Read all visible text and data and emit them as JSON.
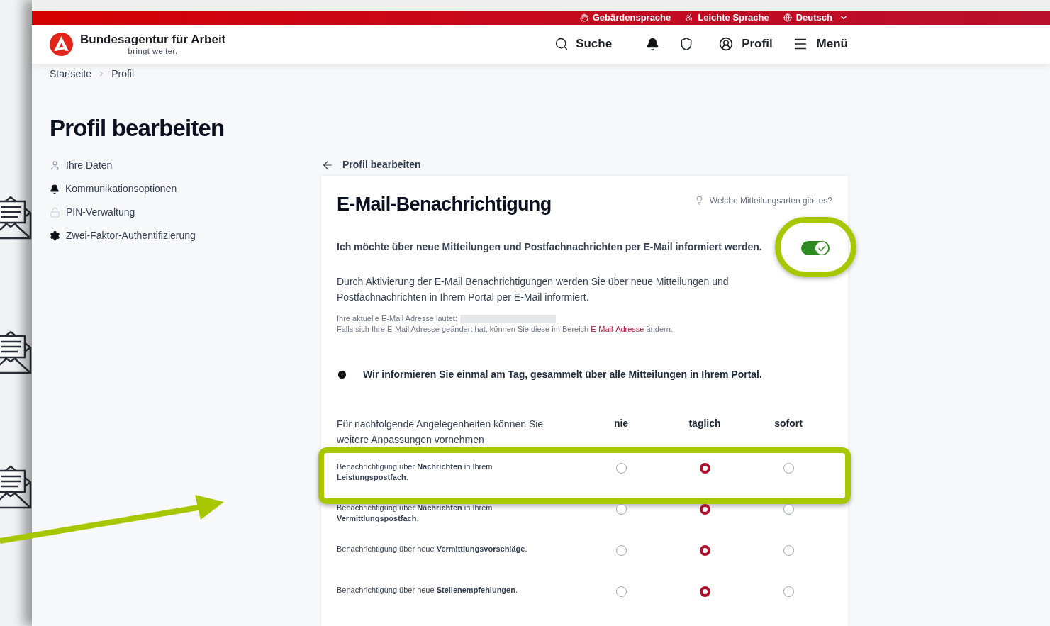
{
  "topbar": {
    "links": [
      {
        "kind": "sign",
        "label": "Gebärdensprache"
      },
      {
        "kind": "easy",
        "label": "Leichte Sprache"
      },
      {
        "kind": "language",
        "label": "Deutsch"
      }
    ]
  },
  "header": {
    "brand": "Bundesagentur für Arbeit",
    "tagline": "bringt weiter.",
    "search": "Suche",
    "profile": "Profil",
    "menu": "Menü"
  },
  "breadcrumbs": [
    "Startseite",
    "Profil"
  ],
  "page_title": "Profil bearbeiten",
  "sidebar": {
    "items": [
      {
        "kind": "person",
        "label": "Ihre Daten"
      },
      {
        "kind": "bell",
        "label": "Kommunikationsoptionen"
      },
      {
        "kind": "lock",
        "label": "PIN-Verwaltung"
      },
      {
        "kind": "gear",
        "label": "Zwei-Faktor-Authentifizierung"
      }
    ]
  },
  "back_link": "Profil bearbeiten",
  "card": {
    "title": "E-Mail-Benachrichtigung",
    "help_link": "Welche Mitteilungsarten gibt es?",
    "toggle": {
      "label": "Ich möchte über neue Mitteilungen und Postfachnachrichten per E-Mail informiert werden.",
      "on": true
    },
    "description": "Durch Aktivierung der E-Mail Benachrichtigungen werden Sie über neue Mitteilungen und Postfachnachrichten in Ihrem Portal per E-Mail informiert.",
    "email_label": "Ihre aktuelle E-Mail Adresse lautet:",
    "change_text": "Falls sich Ihre E-Mail Adresse geändert hat, können Sie diese im Bereich",
    "change_link": "E-Mail-Adresse",
    "change_suffix": "ändern.",
    "info": "Wir informieren Sie einmal am Tag, gesammelt über alle Mitteilungen in Ihrem Portal.",
    "matrix": {
      "intro": "Für nachfolgende Angelegenheiten können Sie weitere Anpassungen vornehmen",
      "columns": [
        "nie",
        "täglich",
        "sofort"
      ],
      "rows": [
        {
          "label": "Benachrichtigung über **Nachrichten** in Ihrem **Leistungspostfach**.",
          "highlighted": true,
          "options": [
            {
              "selected": false
            },
            {
              "selected": true
            },
            {
              "selected": false
            }
          ]
        },
        {
          "label": "Benachrichtigung über **Nachrichten** in Ihrem **Vermittlungspostfach**.",
          "highlighted": false,
          "options": [
            {
              "selected": false
            },
            {
              "selected": true
            },
            {
              "selected": false
            }
          ]
        },
        {
          "label": "Benachrichtigung über neue **Vermittlungsvorschläge**.",
          "highlighted": false,
          "options": [
            {
              "selected": false
            },
            {
              "selected": true
            },
            {
              "selected": false
            }
          ]
        },
        {
          "label": "Benachrichtigung über neue **Stellenempfehlungen**.",
          "highlighted": false,
          "options": [
            {
              "selected": false
            },
            {
              "selected": true
            },
            {
              "selected": false
            }
          ]
        }
      ]
    }
  }
}
